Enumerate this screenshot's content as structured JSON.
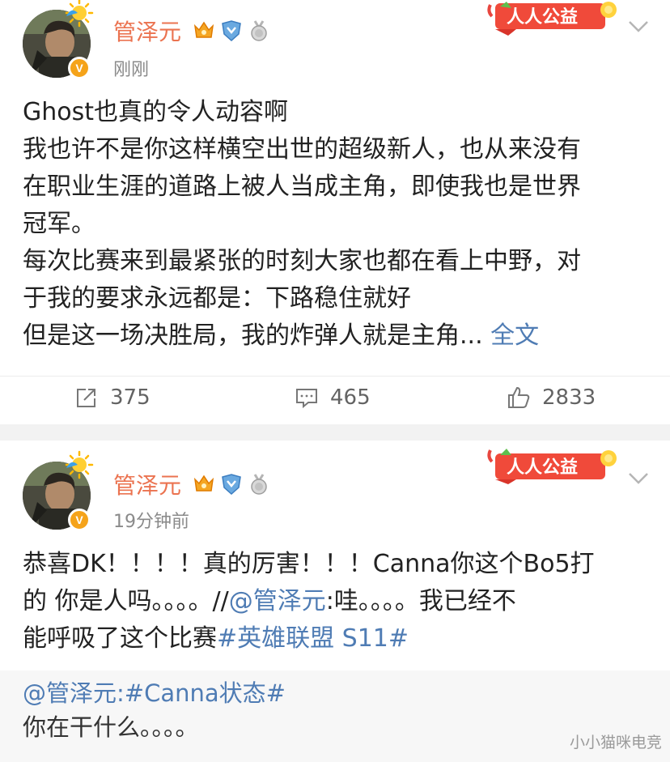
{
  "colors": {
    "username": "#eb7350",
    "link": "#4f7cb4",
    "muted": "#8a8a8a",
    "separator": "#f2f2f2",
    "quote_bg": "#f7f7f7"
  },
  "icons": {
    "badges": [
      "crown-badge-icon",
      "team-shield-badge-icon",
      "medal-badge-icon"
    ],
    "verified": "verified-v-icon",
    "charity": "renren-charity-badge",
    "more": "chevron-down-icon",
    "repost": "repost-icon",
    "comment": "comment-icon",
    "like": "like-icon"
  },
  "posts": [
    {
      "username": "管泽元",
      "timestamp": "刚刚",
      "verified_label": "V",
      "charity_label": "人人公益",
      "lines": [
        "Ghost也真的令人动容啊",
        "我也许不是你这样横空出世的超级新人，也从来没有",
        "在职业生涯的道路上被人当成主角，即使我也是世界",
        "冠军。",
        "每次比赛来到最紧张的时刻大家也都在看上中野，对",
        "于我的要求永远都是：下路稳住就好",
        "但是这一场决胜局，我的炸弹人就是主角..."
      ],
      "full_text_link": "全文",
      "reposts": "375",
      "comments": "465",
      "likes": "2833"
    },
    {
      "username": "管泽元",
      "timestamp": "19分钟前",
      "verified_label": "V",
      "charity_label": "人人公益",
      "line1": "恭喜DK！！！！真的厉害！！！Canna你这个Bo5打",
      "line2_prefix": "的 你是人吗。。。。//",
      "line2_mention": "@管泽元",
      "line2_suffix": ":哇。。。。我已经不",
      "line3_text": "能呼吸了这个比赛",
      "line3_topic": "#英雄联盟 S11#",
      "quote": {
        "mention": "@管泽元",
        "colon": ":",
        "topic": "#Canna状态#",
        "text": "你在干什么。。。。"
      }
    }
  ],
  "watermark": "小小猫咪电竞"
}
